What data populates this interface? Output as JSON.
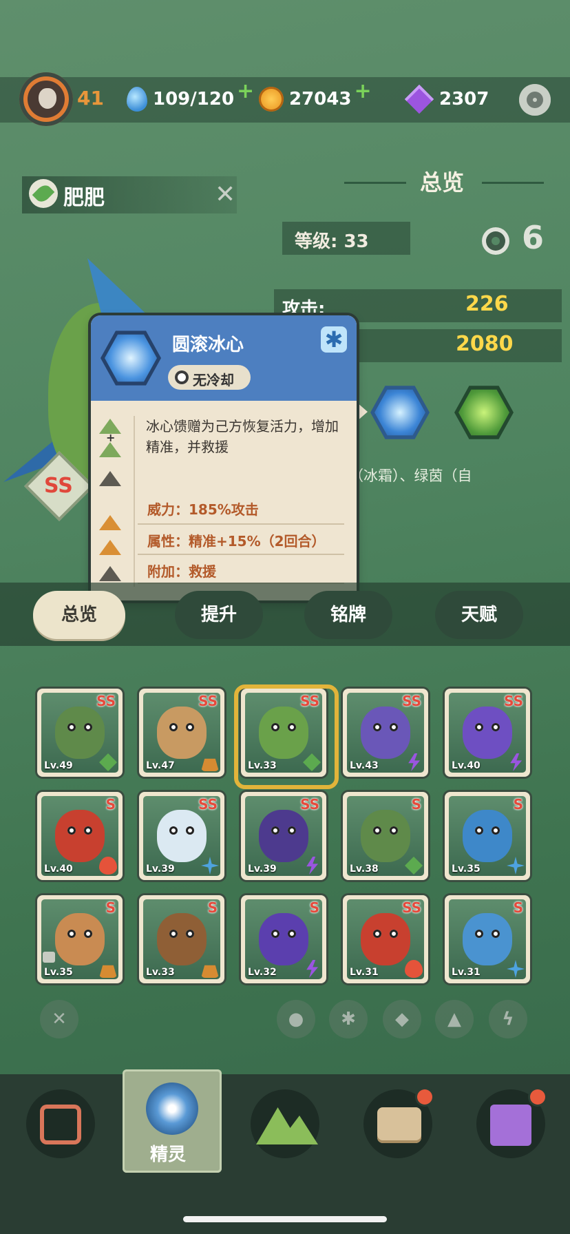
{
  "player": {
    "level": "41"
  },
  "resources": {
    "energy": "109/120",
    "coins": "27043",
    "gems": "2307"
  },
  "pet": {
    "name": "肥肥"
  },
  "overview": {
    "title": "总览",
    "level_label": "等级: 33",
    "star_count": "6",
    "attack_label": "攻击:",
    "attack_value": "226",
    "hp_value": "2080",
    "element_desc": "龙（冰霜）、绿茵（自\n地）"
  },
  "rank_badge": "SS",
  "tooltip": {
    "title": "圆滚冰心",
    "cooldown": "无冷却",
    "description": "冰心馈赠为己方恢复活力，增加精准，并救援",
    "power": "威力：185%攻击",
    "attribute": "属性：精准+15%（2回合）",
    "extra": "附加：救援"
  },
  "tabs": [
    "总览",
    "提升",
    "铭牌",
    "天赋"
  ],
  "cards": [
    {
      "lv": "Lv.49",
      "rank": "SS",
      "elem": "leaf",
      "color": "#5f8a4a"
    },
    {
      "lv": "Lv.47",
      "rank": "SS",
      "elem": "earth",
      "color": "#c89a62"
    },
    {
      "lv": "Lv.33",
      "rank": "SS",
      "elem": "leaf",
      "color": "#6aa14a"
    },
    {
      "lv": "Lv.43",
      "rank": "SS",
      "elem": "elec",
      "color": "#6a57b8"
    },
    {
      "lv": "Lv.40",
      "rank": "SS",
      "elem": "elec",
      "color": "#6e4fc2"
    },
    {
      "lv": "Lv.40",
      "rank": "S",
      "elem": "fire",
      "color": "#c8402f"
    },
    {
      "lv": "Lv.39",
      "rank": "SS",
      "elem": "frost",
      "color": "#dbe9f2"
    },
    {
      "lv": "Lv.39",
      "rank": "SS",
      "elem": "elec",
      "color": "#4d3a8e"
    },
    {
      "lv": "Lv.38",
      "rank": "S",
      "elem": "leaf",
      "color": "#5f8a4a"
    },
    {
      "lv": "Lv.35",
      "rank": "S",
      "elem": "frost",
      "color": "#3e88c9"
    },
    {
      "lv": "Lv.35",
      "rank": "S",
      "elem": "earth",
      "color": "#c98b52"
    },
    {
      "lv": "Lv.33",
      "rank": "S",
      "elem": "earth",
      "color": "#8f5f36"
    },
    {
      "lv": "Lv.32",
      "rank": "S",
      "elem": "elec",
      "color": "#5b3fae"
    },
    {
      "lv": "Lv.31",
      "rank": "SS",
      "elem": "fire",
      "color": "#c8402f"
    },
    {
      "lv": "Lv.31",
      "rank": "S",
      "elem": "frost",
      "color": "#4a93d0"
    }
  ],
  "filters": [
    "clear-filter",
    "fire-filter",
    "frost-filter",
    "leaf-filter",
    "earth-filter",
    "electric-filter"
  ],
  "nav": {
    "active_label": "精灵"
  },
  "colors": {
    "accent_gold": "#ffd84a",
    "rank_red": "#e64a3c",
    "tooltip_blue": "#4d7fc0"
  }
}
